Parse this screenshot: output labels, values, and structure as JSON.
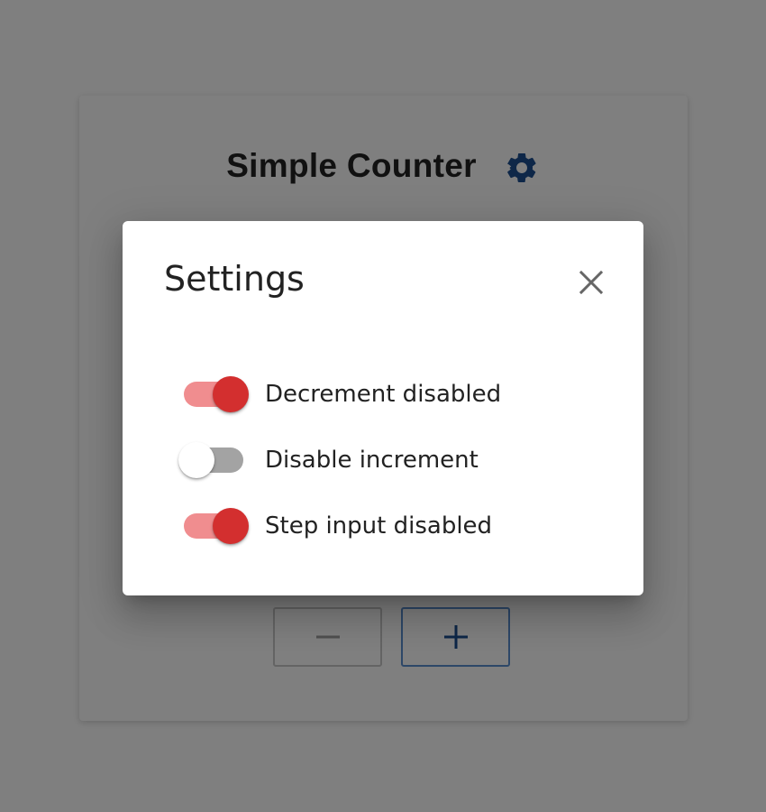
{
  "app": {
    "title": "Simple Counter",
    "settings_icon": "gear-icon",
    "decrement_icon": "minus-icon",
    "increment_icon": "plus-icon"
  },
  "dialog": {
    "title": "Settings",
    "close_icon": "close-icon",
    "toggles": [
      {
        "label": "Decrement disabled",
        "on": true
      },
      {
        "label": "Disable increment",
        "on": false
      },
      {
        "label": "Step input disabled",
        "on": true
      }
    ]
  },
  "colors": {
    "accent_red": "#d32f2f",
    "accent_red_track": "#f08d8f",
    "accent_blue": "#1d4f91",
    "switch_off_track": "#a3a3a3",
    "scrim": "rgba(0,0,0,0.5)"
  }
}
